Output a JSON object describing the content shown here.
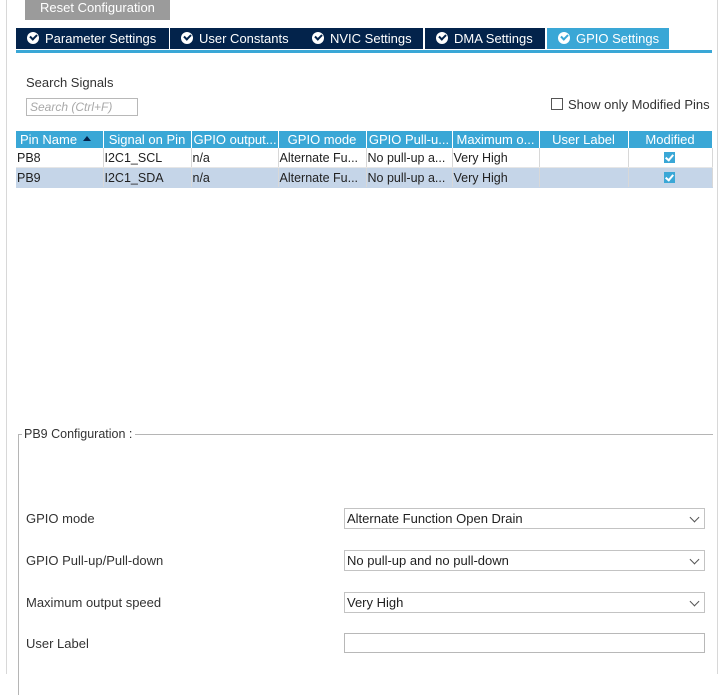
{
  "toolbar": {
    "reset_label": "Reset Configuration"
  },
  "tabs": [
    {
      "label": "Parameter Settings",
      "active": false
    },
    {
      "label": "User Constants",
      "active": false
    },
    {
      "label": "NVIC Settings",
      "active": false
    },
    {
      "label": "DMA Settings",
      "active": false
    },
    {
      "label": "GPIO Settings",
      "active": true
    }
  ],
  "search": {
    "label": "Search Signals",
    "placeholder": "Search (Ctrl+F)",
    "value": ""
  },
  "filter": {
    "show_modified_label": "Show only Modified Pins",
    "checked": false
  },
  "table": {
    "headers": [
      "Pin Name",
      "Signal on Pin",
      "GPIO output...",
      "GPIO mode",
      "GPIO Pull-u...",
      "Maximum o...",
      "User Label",
      "Modified"
    ],
    "sorted_column": "Pin Name",
    "rows": [
      {
        "pin": "PB8",
        "signal": "I2C1_SCL",
        "output": "n/a",
        "mode": "Alternate Fu...",
        "pull": "No pull-up a...",
        "speed": "Very High",
        "label": "",
        "modified": true,
        "selected": false
      },
      {
        "pin": "PB9",
        "signal": "I2C1_SDA",
        "output": "n/a",
        "mode": "Alternate Fu...",
        "pull": "No pull-up a...",
        "speed": "Very High",
        "label": "",
        "modified": true,
        "selected": true
      }
    ]
  },
  "config": {
    "title": "PB9 Configuration :",
    "fields": {
      "gpio_mode": {
        "label": "GPIO mode",
        "value": "Alternate Function Open Drain"
      },
      "pull": {
        "label": "GPIO Pull-up/Pull-down",
        "value": "No pull-up and no pull-down"
      },
      "speed": {
        "label": "Maximum output speed",
        "value": "Very High"
      },
      "user_label": {
        "label": "User Label",
        "value": ""
      }
    }
  },
  "colors": {
    "accent": "#3aa7d6",
    "tab_dark": "#03234b",
    "selection": "#c5d5e8",
    "button_gray": "#9b9b9b"
  },
  "icons": {
    "tab_check": "check-circle-icon",
    "sort": "sort-ascending-icon",
    "dropdown": "chevron-down-icon",
    "modified": "checkbox-checked-icon"
  }
}
